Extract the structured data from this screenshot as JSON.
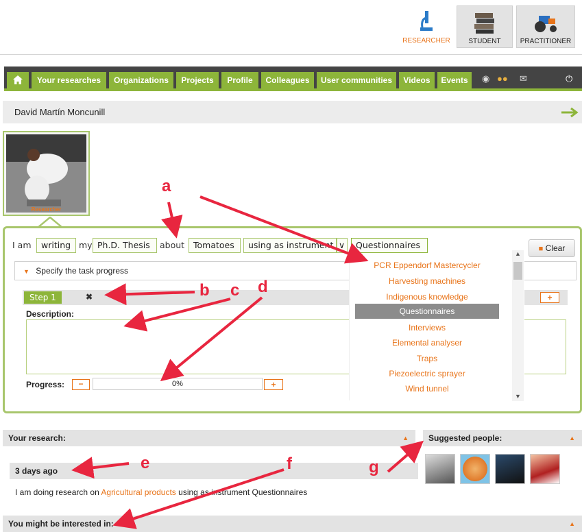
{
  "roles": {
    "researcher": "RESEARCHER",
    "student": "STUDENT",
    "practitioner": "PRACTITIONER"
  },
  "nav": {
    "home_icon": "home-icon",
    "tabs": [
      "Your researches",
      "Organizations",
      "Projects",
      "Profile",
      "Colleagues",
      "User communities",
      "Videos",
      "Events"
    ]
  },
  "user": {
    "name": "David Martín Moncunill",
    "photo_label": "Researcher"
  },
  "task": {
    "i_am": "I am",
    "doing": "writing",
    "my": "my",
    "thing": "Ph.D. Thesis",
    "about": "about",
    "topic": "Tomatoes",
    "instrument_prefix": "using as instrument",
    "instrument": "Questionnaires",
    "clear": "Clear",
    "specify": "Specify the task progress",
    "step": "Step 1",
    "step_close": "✖",
    "add": "+",
    "description": "Description:",
    "progress_label": "Progress:",
    "progress_value": "0%",
    "minus": "−"
  },
  "dropdown": {
    "items": [
      "PCR Eppendorf Mastercycler",
      "Harvesting machines",
      "Indigenous knowledge",
      "Questionnaires",
      "Interviews",
      "Elemental analyser",
      "Traps",
      "Piezoelectric sprayer",
      "Wind tunnel"
    ],
    "selected_index": 3
  },
  "research": {
    "title": "Your research:",
    "ago": "3 days ago",
    "text_before": "I am doing research on",
    "topic": "Agricultural products",
    "text_after": "using as instrument Questionnaires"
  },
  "suggested": {
    "title": "Suggested people:"
  },
  "interest": {
    "title": "You might be interested in:"
  },
  "annotations": [
    "a",
    "b",
    "c",
    "d",
    "e",
    "f",
    "g"
  ],
  "colors": {
    "green": "#8db53a",
    "orange": "#e8741a",
    "nav": "#444444",
    "arrow": "#e8263f"
  }
}
